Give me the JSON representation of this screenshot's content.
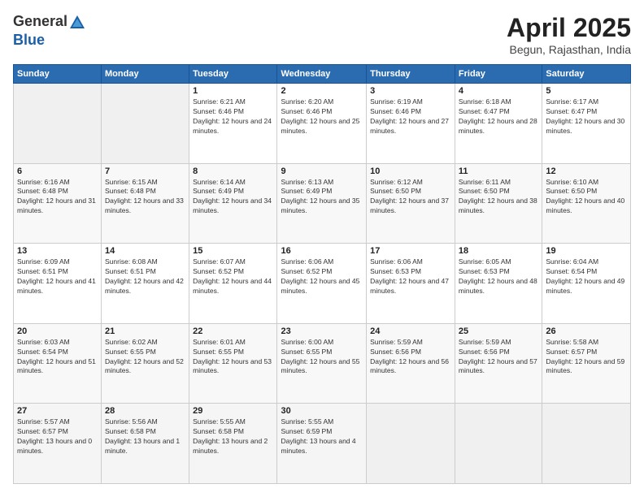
{
  "header": {
    "logo_general": "General",
    "logo_blue": "Blue",
    "title": "April 2025",
    "location": "Begun, Rajasthan, India"
  },
  "days_of_week": [
    "Sunday",
    "Monday",
    "Tuesday",
    "Wednesday",
    "Thursday",
    "Friday",
    "Saturday"
  ],
  "weeks": [
    [
      {
        "day": "",
        "empty": true
      },
      {
        "day": "",
        "empty": true
      },
      {
        "day": "1",
        "sunrise": "Sunrise: 6:21 AM",
        "sunset": "Sunset: 6:46 PM",
        "daylight": "Daylight: 12 hours and 24 minutes."
      },
      {
        "day": "2",
        "sunrise": "Sunrise: 6:20 AM",
        "sunset": "Sunset: 6:46 PM",
        "daylight": "Daylight: 12 hours and 25 minutes."
      },
      {
        "day": "3",
        "sunrise": "Sunrise: 6:19 AM",
        "sunset": "Sunset: 6:46 PM",
        "daylight": "Daylight: 12 hours and 27 minutes."
      },
      {
        "day": "4",
        "sunrise": "Sunrise: 6:18 AM",
        "sunset": "Sunset: 6:47 PM",
        "daylight": "Daylight: 12 hours and 28 minutes."
      },
      {
        "day": "5",
        "sunrise": "Sunrise: 6:17 AM",
        "sunset": "Sunset: 6:47 PM",
        "daylight": "Daylight: 12 hours and 30 minutes."
      }
    ],
    [
      {
        "day": "6",
        "sunrise": "Sunrise: 6:16 AM",
        "sunset": "Sunset: 6:48 PM",
        "daylight": "Daylight: 12 hours and 31 minutes."
      },
      {
        "day": "7",
        "sunrise": "Sunrise: 6:15 AM",
        "sunset": "Sunset: 6:48 PM",
        "daylight": "Daylight: 12 hours and 33 minutes."
      },
      {
        "day": "8",
        "sunrise": "Sunrise: 6:14 AM",
        "sunset": "Sunset: 6:49 PM",
        "daylight": "Daylight: 12 hours and 34 minutes."
      },
      {
        "day": "9",
        "sunrise": "Sunrise: 6:13 AM",
        "sunset": "Sunset: 6:49 PM",
        "daylight": "Daylight: 12 hours and 35 minutes."
      },
      {
        "day": "10",
        "sunrise": "Sunrise: 6:12 AM",
        "sunset": "Sunset: 6:50 PM",
        "daylight": "Daylight: 12 hours and 37 minutes."
      },
      {
        "day": "11",
        "sunrise": "Sunrise: 6:11 AM",
        "sunset": "Sunset: 6:50 PM",
        "daylight": "Daylight: 12 hours and 38 minutes."
      },
      {
        "day": "12",
        "sunrise": "Sunrise: 6:10 AM",
        "sunset": "Sunset: 6:50 PM",
        "daylight": "Daylight: 12 hours and 40 minutes."
      }
    ],
    [
      {
        "day": "13",
        "sunrise": "Sunrise: 6:09 AM",
        "sunset": "Sunset: 6:51 PM",
        "daylight": "Daylight: 12 hours and 41 minutes."
      },
      {
        "day": "14",
        "sunrise": "Sunrise: 6:08 AM",
        "sunset": "Sunset: 6:51 PM",
        "daylight": "Daylight: 12 hours and 42 minutes."
      },
      {
        "day": "15",
        "sunrise": "Sunrise: 6:07 AM",
        "sunset": "Sunset: 6:52 PM",
        "daylight": "Daylight: 12 hours and 44 minutes."
      },
      {
        "day": "16",
        "sunrise": "Sunrise: 6:06 AM",
        "sunset": "Sunset: 6:52 PM",
        "daylight": "Daylight: 12 hours and 45 minutes."
      },
      {
        "day": "17",
        "sunrise": "Sunrise: 6:06 AM",
        "sunset": "Sunset: 6:53 PM",
        "daylight": "Daylight: 12 hours and 47 minutes."
      },
      {
        "day": "18",
        "sunrise": "Sunrise: 6:05 AM",
        "sunset": "Sunset: 6:53 PM",
        "daylight": "Daylight: 12 hours and 48 minutes."
      },
      {
        "day": "19",
        "sunrise": "Sunrise: 6:04 AM",
        "sunset": "Sunset: 6:54 PM",
        "daylight": "Daylight: 12 hours and 49 minutes."
      }
    ],
    [
      {
        "day": "20",
        "sunrise": "Sunrise: 6:03 AM",
        "sunset": "Sunset: 6:54 PM",
        "daylight": "Daylight: 12 hours and 51 minutes."
      },
      {
        "day": "21",
        "sunrise": "Sunrise: 6:02 AM",
        "sunset": "Sunset: 6:55 PM",
        "daylight": "Daylight: 12 hours and 52 minutes."
      },
      {
        "day": "22",
        "sunrise": "Sunrise: 6:01 AM",
        "sunset": "Sunset: 6:55 PM",
        "daylight": "Daylight: 12 hours and 53 minutes."
      },
      {
        "day": "23",
        "sunrise": "Sunrise: 6:00 AM",
        "sunset": "Sunset: 6:55 PM",
        "daylight": "Daylight: 12 hours and 55 minutes."
      },
      {
        "day": "24",
        "sunrise": "Sunrise: 5:59 AM",
        "sunset": "Sunset: 6:56 PM",
        "daylight": "Daylight: 12 hours and 56 minutes."
      },
      {
        "day": "25",
        "sunrise": "Sunrise: 5:59 AM",
        "sunset": "Sunset: 6:56 PM",
        "daylight": "Daylight: 12 hours and 57 minutes."
      },
      {
        "day": "26",
        "sunrise": "Sunrise: 5:58 AM",
        "sunset": "Sunset: 6:57 PM",
        "daylight": "Daylight: 12 hours and 59 minutes."
      }
    ],
    [
      {
        "day": "27",
        "sunrise": "Sunrise: 5:57 AM",
        "sunset": "Sunset: 6:57 PM",
        "daylight": "Daylight: 13 hours and 0 minutes."
      },
      {
        "day": "28",
        "sunrise": "Sunrise: 5:56 AM",
        "sunset": "Sunset: 6:58 PM",
        "daylight": "Daylight: 13 hours and 1 minute."
      },
      {
        "day": "29",
        "sunrise": "Sunrise: 5:55 AM",
        "sunset": "Sunset: 6:58 PM",
        "daylight": "Daylight: 13 hours and 2 minutes."
      },
      {
        "day": "30",
        "sunrise": "Sunrise: 5:55 AM",
        "sunset": "Sunset: 6:59 PM",
        "daylight": "Daylight: 13 hours and 4 minutes."
      },
      {
        "day": "",
        "empty": true
      },
      {
        "day": "",
        "empty": true
      },
      {
        "day": "",
        "empty": true
      }
    ]
  ]
}
